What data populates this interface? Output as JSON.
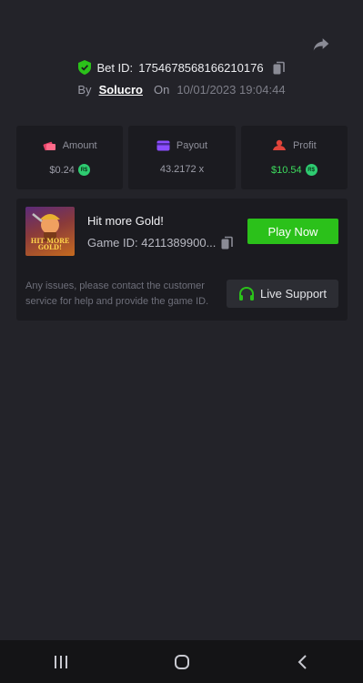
{
  "header": {
    "bet_id_label": "Bet ID:",
    "bet_id": "1754678568166210176",
    "by_label": "By",
    "user": "Solucro",
    "on_label": "On",
    "datetime": "10/01/2023 19:04:44"
  },
  "stats": {
    "amount": {
      "label": "Amount",
      "value": "$0.24",
      "coin": "R$"
    },
    "payout": {
      "label": "Payout",
      "value": "43.2172 x"
    },
    "profit": {
      "label": "Profit",
      "value": "$10.54",
      "coin": "R$"
    }
  },
  "game": {
    "thumb_text": "HIT MORE GOLD!",
    "title": "Hit more Gold!",
    "game_id": "Game ID: 4211389900...",
    "play_label": "Play Now",
    "notice": "Any issues, please contact the customer service for help and provide the game ID.",
    "support_label": "Live Support"
  },
  "colors": {
    "background": "#232329",
    "card": "#1b1b20",
    "accent_green": "#2bc11a",
    "profit_green": "#3ddc5d",
    "amount_icon": "#e8456b",
    "payout_icon": "#8b4dff",
    "profit_icon": "#e0443a"
  },
  "icons": [
    "share-icon",
    "shield-check-icon",
    "copy-icon",
    "amount-icon",
    "payout-card-icon",
    "profit-icon",
    "headset-icon",
    "recent-apps-icon",
    "home-icon",
    "back-icon"
  ]
}
